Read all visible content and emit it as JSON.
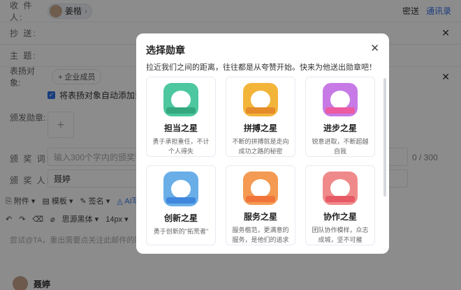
{
  "compose": {
    "to_label": "收 件 人:",
    "to_recipient": "姜楷",
    "cc_link": "密送",
    "contacts_link": "通讯录",
    "cc_label": "抄    送:",
    "subject_label": "主    题:",
    "praise_label": "表扬对象:",
    "add_member_label": "+ 企业成员",
    "auto_add_text": "将表扬对象自动添加到邮件",
    "medal_label": "颁发勋章:",
    "award_words_label": "颁 奖 词:",
    "award_words_placeholder": "输入300个字内的颁奖词",
    "counter": "0 / 300",
    "presenter_label": "颁 奖 人:",
    "presenter_value": "聂婷",
    "toolbar": {
      "attach": "附件",
      "template": "模板",
      "signature": "签名",
      "ai": "AI写信",
      "font": "思源黑体",
      "size": "14px"
    },
    "body_placeholder": "尝试@TA，重出需要点关注此邮件的联系人",
    "sender_name": "聂婷"
  },
  "modal": {
    "title": "选择勋章",
    "subtitle": "拉近我们之间的距离，往往都是从夸赞开始。快来为他送出勋章吧！",
    "badges": [
      {
        "name": "担当之星",
        "desc": "勇于承担重任，不计个人得失",
        "color": "#4cc7a0",
        "ribbon": "#34a77f"
      },
      {
        "name": "拼搏之星",
        "desc": "不断的拼搏就是走向成功之路的秘密",
        "color": "#f3b43a",
        "ribbon": "#e58b2a"
      },
      {
        "name": "进步之星",
        "desc": "锐意进取，不断超越自我",
        "color": "#c77ae6",
        "ribbon": "#ec5aa0"
      },
      {
        "name": "创新之星",
        "desc": "勇于创新的\"拓荒者\"",
        "color": "#6aaee8",
        "ribbon": "#3f86dd"
      },
      {
        "name": "服务之星",
        "desc": "服务楷范，更满意的服务，是他们的追求",
        "color": "#f49a52",
        "ribbon": "#f1743a"
      },
      {
        "name": "协作之星",
        "desc": "团队协作模样，众志成城，坚不可摧",
        "color": "#f08a8a",
        "ribbon": "#e65a66"
      }
    ]
  }
}
